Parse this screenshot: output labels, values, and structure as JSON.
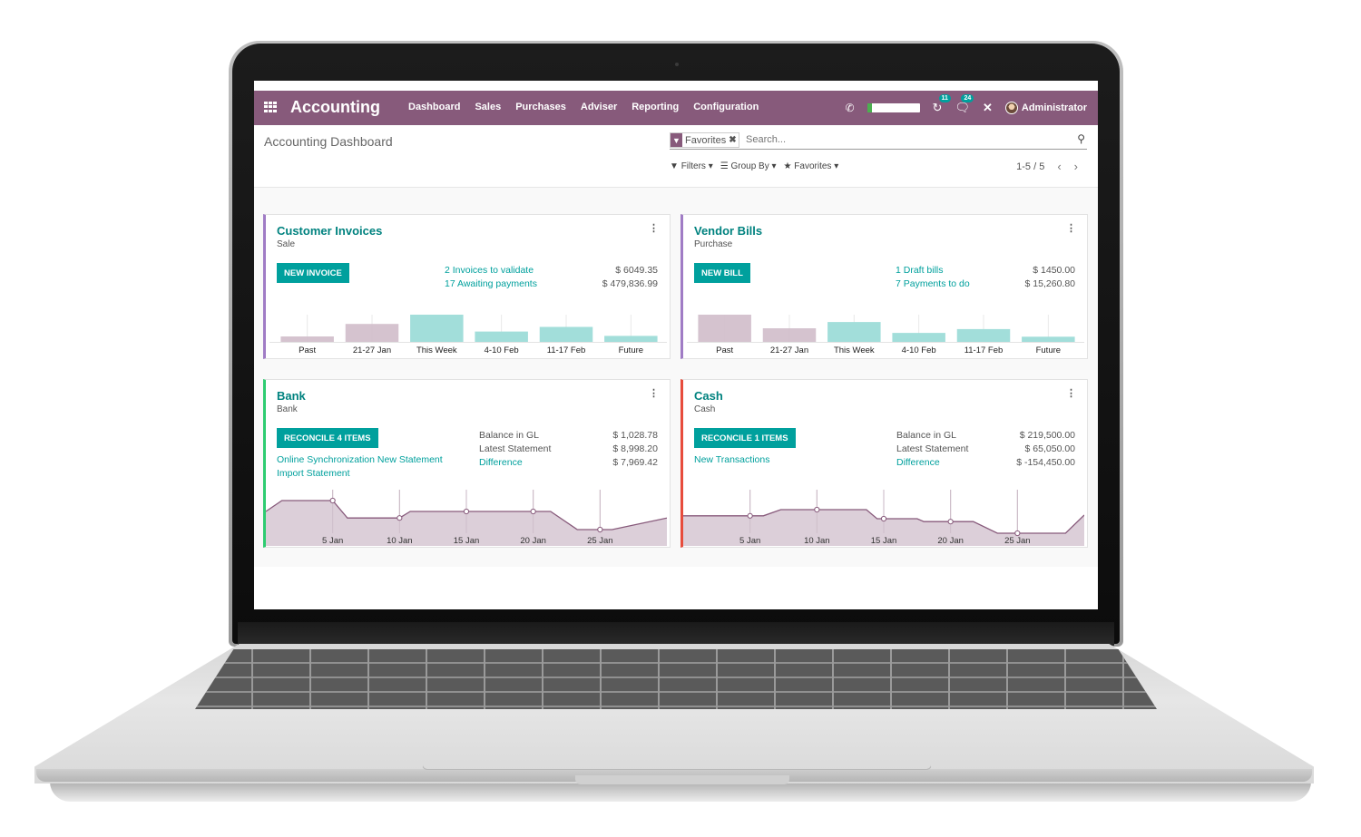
{
  "navbar": {
    "app_title": "Accounting",
    "menu": [
      "Dashboard",
      "Sales",
      "Purchases",
      "Adviser",
      "Reporting",
      "Configuration"
    ],
    "activity_count": "11",
    "messages_count": "24",
    "progress_fraction": 0.1,
    "user_name": "Administrator"
  },
  "control_panel": {
    "title": "Accounting Dashboard",
    "facet_label": "Favorites",
    "search_placeholder": "Search...",
    "filters_label": "Filters",
    "groupby_label": "Group By",
    "favorites_label": "Favorites",
    "pager": "1-5 / 5"
  },
  "cards": {
    "customer_invoices": {
      "title": "Customer Invoices",
      "subtitle": "Sale",
      "button": "NEW INVOICE",
      "links": [
        "2 Invoices to validate",
        "17 Awaiting payments"
      ],
      "values": [
        "$ 6049.35",
        "$ 479,836.99"
      ],
      "accent": "#a07cc5"
    },
    "vendor_bills": {
      "title": "Vendor Bills",
      "subtitle": "Purchase",
      "button": "NEW BILL",
      "links": [
        "1 Draft bills",
        "7 Payments to do"
      ],
      "values": [
        "$ 1450.00",
        "$ 15,260.80"
      ],
      "accent": "#a07cc5"
    },
    "bank": {
      "title": "Bank",
      "subtitle": "Bank",
      "button": "RECONCILE 4 ITEMS",
      "left_links": [
        "Online Synchronization New Statement",
        "Import Statement"
      ],
      "labels": [
        "Balance in GL",
        "Latest Statement"
      ],
      "difference_label": "Difference",
      "values": [
        "$ 1,028.78",
        "$ 8,998.20",
        "$ 7,969.42"
      ],
      "accent": "#2ecc71"
    },
    "cash": {
      "title": "Cash",
      "subtitle": "Cash",
      "button": "RECONCILE 1 ITEMS",
      "left_links": [
        "New Transactions"
      ],
      "labels": [
        "Balance in GL",
        "Latest Statement"
      ],
      "difference_label": "Difference",
      "values": [
        "$ 219,500.00",
        "$ 65,050.00",
        "$ -154,450.00"
      ],
      "accent": "#e74c3c"
    }
  },
  "colors": {
    "brand": "#875a7b",
    "teal": "#00a09d",
    "bar_past": "#d3c0cc",
    "bar_future": "#9ddcd8",
    "area_fill": "#dccfd9",
    "area_line": "#875a7b"
  },
  "chart_data": [
    {
      "id": "customer_invoices",
      "type": "bar",
      "categories": [
        "Past",
        "21-27 Jan",
        "This Week",
        "4-10 Feb",
        "11-17 Feb",
        "Future"
      ],
      "values": [
        0.2,
        0.66,
        1.0,
        0.38,
        0.55,
        0.22
      ],
      "category_kind": [
        "past",
        "past",
        "future",
        "future",
        "future",
        "future"
      ],
      "ylabel": "relative amount (no axis shown)"
    },
    {
      "id": "vendor_bills",
      "type": "bar",
      "categories": [
        "Past",
        "21-27 Jan",
        "This Week",
        "4-10 Feb",
        "11-17 Feb",
        "Future"
      ],
      "values": [
        1.0,
        0.5,
        0.73,
        0.33,
        0.47,
        0.19
      ],
      "category_kind": [
        "past",
        "past",
        "future",
        "future",
        "future",
        "future"
      ],
      "ylabel": "relative amount (no axis shown)"
    },
    {
      "id": "bank",
      "type": "area",
      "x_ticks": [
        "5 Jan",
        "10 Jan",
        "15 Jan",
        "20 Jan",
        "25 Jan"
      ],
      "x_days": [
        0,
        1.2,
        3.2,
        5,
        6.1,
        8,
        10,
        10.8,
        12.5,
        20,
        21.3,
        23.3,
        25,
        25.9,
        30
      ],
      "y": [
        0.7,
        1.0,
        1.0,
        1.0,
        0.52,
        0.52,
        0.52,
        0.7,
        0.7,
        0.7,
        0.7,
        0.2,
        0.2,
        0.2,
        0.52
      ],
      "markers_at": [
        "5 Jan",
        "10 Jan",
        "15 Jan",
        "20 Jan",
        "25 Jan"
      ],
      "ylim": [
        0,
        1.3
      ]
    },
    {
      "id": "cash",
      "type": "area",
      "x_days": [
        0,
        5,
        6,
        7.3,
        10,
        13.7,
        14.5,
        15,
        17.5,
        18,
        20,
        21.7,
        23.5,
        25,
        28.6,
        30
      ],
      "y": [
        0.58,
        0.58,
        0.58,
        0.75,
        0.75,
        0.75,
        0.5,
        0.5,
        0.5,
        0.42,
        0.42,
        0.42,
        0.1,
        0.1,
        0.1,
        0.6
      ],
      "x_ticks": [
        "5 Jan",
        "10 Jan",
        "15 Jan",
        "20 Jan",
        "25 Jan"
      ],
      "markers_at": [
        "5 Jan",
        "10 Jan",
        "15 Jan",
        "20 Jan",
        "25 Jan"
      ],
      "ylim": [
        0,
        1.3
      ]
    }
  ]
}
